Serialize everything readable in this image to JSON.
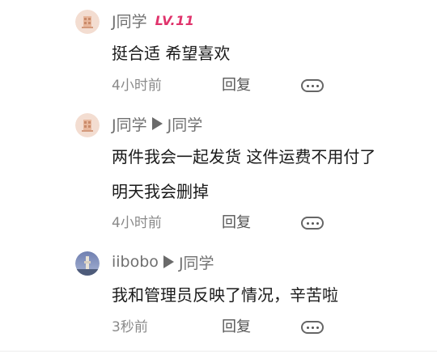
{
  "comments": [
    {
      "author": "J同学",
      "level": "LV.11",
      "text": "挺合适 希望喜欢",
      "time": "4小时前",
      "reply_label": "回复"
    },
    {
      "author": "J同学",
      "reply_to": "J同学",
      "text_line1": "两件我会一起发货 这件运费不用付了",
      "text_line2": "明天我会删掉",
      "time": "4小时前",
      "reply_label": "回复"
    },
    {
      "author": "iibobo",
      "reply_to": "J同学",
      "text": "我和管理员反映了情况，辛苦啦",
      "time": "3秒前",
      "reply_label": "回复"
    }
  ],
  "icons": {
    "more": "more-options-icon",
    "reply_to": "triangle-right-icon"
  },
  "colors": {
    "level_badge": "#e0346c",
    "name": "#707070",
    "text": "#1a1a1a",
    "time": "#8a8a8a"
  }
}
